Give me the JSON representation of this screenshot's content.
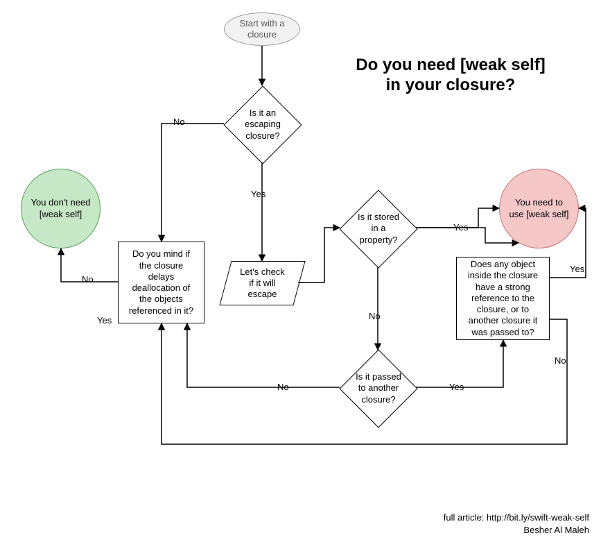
{
  "title": "Do you need [weak self]\nin your closure?",
  "start": "Start with a\nclosure",
  "q_escaping": "Is it an\nescaping\nclosure?",
  "q_mind": "Do you mind if\nthe closure\ndelays\ndeallocation of\nthe objects\nreferenced in it?",
  "lets_check": "Let's check\nif it will\nescape",
  "q_stored": "Is it stored\nin a\nproperty?",
  "q_passed": "Is it passed\nto another\nclosure?",
  "q_strongref": "Does any object\ninside the closure\nhave a strong\nreference to the\nclosure, or to\nanother closure it\nwas passed to?",
  "terminal_no": "You don't need\n[weak self]",
  "terminal_yes": "You need to\nuse [weak self]",
  "labels": {
    "yes": "Yes",
    "no": "No"
  },
  "footer_article": "full article: http://bit.ly/swift-weak-self",
  "footer_author": "Besher Al Maleh",
  "chart_data": {
    "type": "flowchart",
    "title": "Do you need [weak self] in your closure?",
    "nodes": [
      {
        "id": "start",
        "kind": "terminator",
        "label": "Start with a closure"
      },
      {
        "id": "escaping",
        "kind": "decision",
        "label": "Is it an escaping closure?"
      },
      {
        "id": "mind",
        "kind": "process",
        "label": "Do you mind if the closure delays deallocation of the objects referenced in it?"
      },
      {
        "id": "check",
        "kind": "io",
        "label": "Let's check if it will escape"
      },
      {
        "id": "stored",
        "kind": "decision",
        "label": "Is it stored in a property?"
      },
      {
        "id": "passed",
        "kind": "decision",
        "label": "Is it passed to another closure?"
      },
      {
        "id": "strongref",
        "kind": "process",
        "label": "Does any object inside the closure have a strong reference to the closure, or to another closure it was passed to?"
      },
      {
        "id": "need",
        "kind": "terminator",
        "label": "You need to use [weak self]"
      },
      {
        "id": "dontneed",
        "kind": "terminator",
        "label": "You don't need [weak self]"
      }
    ],
    "edges": [
      {
        "from": "start",
        "to": "escaping",
        "label": ""
      },
      {
        "from": "escaping",
        "to": "mind",
        "label": "No"
      },
      {
        "from": "escaping",
        "to": "check",
        "label": "Yes"
      },
      {
        "from": "check",
        "to": "stored",
        "label": ""
      },
      {
        "from": "stored",
        "to": "need",
        "label": "Yes"
      },
      {
        "from": "stored",
        "to": "passed",
        "label": "No"
      },
      {
        "from": "passed",
        "to": "strongref",
        "label": "Yes"
      },
      {
        "from": "passed",
        "to": "mind",
        "label": "No"
      },
      {
        "from": "strongref",
        "to": "need",
        "label": "Yes"
      },
      {
        "from": "strongref",
        "to": "mind",
        "label": "No"
      },
      {
        "from": "mind",
        "to": "dontneed",
        "label": "No"
      },
      {
        "from": "mind",
        "to": "start",
        "label": "Yes"
      }
    ]
  }
}
